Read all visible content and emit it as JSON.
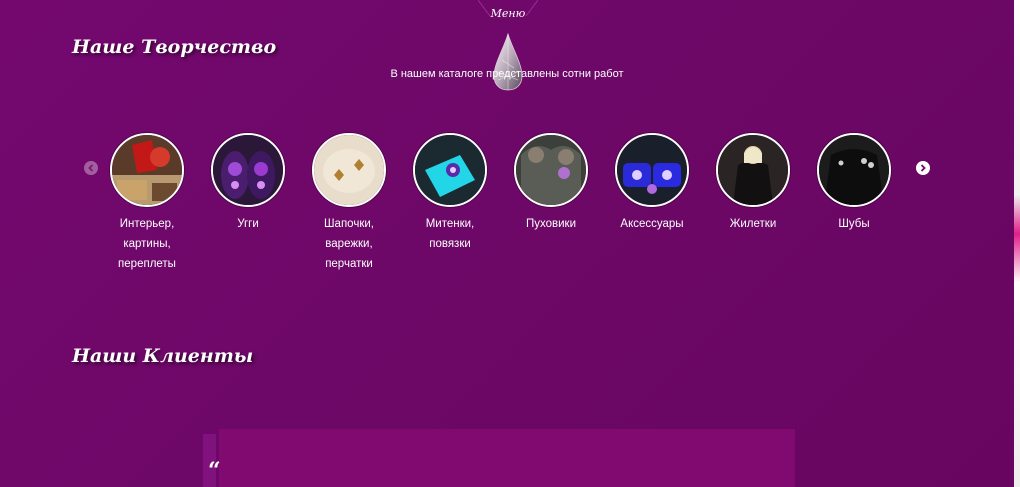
{
  "header": {
    "menu_label": "Меню"
  },
  "creativity": {
    "title": "Наше Творчество",
    "subtitle": "В нашем каталоге представлены сотни работ",
    "prev_icon": "chevron-left-icon",
    "next_icon": "chevron-right-icon",
    "categories": [
      {
        "label": "Интерьер,\nкартины,\nпереплеты",
        "image": "interior-paintings-photo"
      },
      {
        "label": "Угги",
        "image": "uggs-photo"
      },
      {
        "label": "Шапочки,\nварежки,\nперчатки",
        "image": "hats-photo"
      },
      {
        "label": "Митенки,\nповязки",
        "image": "mittens-photo"
      },
      {
        "label": "Пуховики",
        "image": "down-jackets-photo"
      },
      {
        "label": "Аксессуары",
        "image": "accessories-photo"
      },
      {
        "label": "Жилетки",
        "image": "vests-photo"
      },
      {
        "label": "Шубы",
        "image": "fur-coats-photo"
      }
    ]
  },
  "clients": {
    "title": "Наши Клиенты",
    "quote_mark": "“"
  },
  "colors": {
    "background": "#6e0868",
    "accent": "#e0208a",
    "card": "#800a6f"
  }
}
